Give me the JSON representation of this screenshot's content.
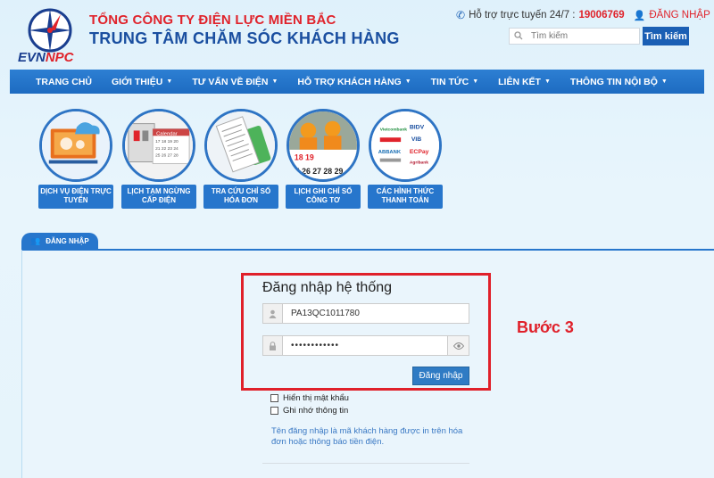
{
  "header": {
    "logo_main": "EVN",
    "logo_sub": "NPC",
    "company": "TỔNG CÔNG TY ĐIỆN LỰC MIỀN BẮC",
    "center_title": "TRUNG TÂM CHĂM SÓC KHÁCH HÀNG",
    "support_label": "Hỗ trợ trực tuyến 24/7 :",
    "hotline": "19006769",
    "login_link": "ĐĂNG NHẬP",
    "search_placeholder": "Tìm kiếm",
    "search_button": "Tìm kiếm"
  },
  "nav": {
    "items": [
      {
        "label": "TRANG CHỦ",
        "caret": false
      },
      {
        "label": "GIỚI THIỆU",
        "caret": true
      },
      {
        "label": "TƯ VẤN VỀ ĐIỆN",
        "caret": true
      },
      {
        "label": "HỖ TRỢ KHÁCH HÀNG",
        "caret": true
      },
      {
        "label": "TIN TỨC",
        "caret": true
      },
      {
        "label": "LIÊN KẾT",
        "caret": true
      },
      {
        "label": "THÔNG TIN NỘI BỘ",
        "caret": true
      }
    ]
  },
  "tiles": [
    {
      "line1": "DỊCH VỤ ĐIỆN TRỰC",
      "line2": "TUYẾN"
    },
    {
      "line1": "LỊCH TẠM NGỪNG",
      "line2": "CẤP ĐIỆN"
    },
    {
      "line1": "TRA CỨU CHỈ SỐ",
      "line2": "HÓA ĐƠN"
    },
    {
      "line1": "LỊCH GHI CHỈ SỐ",
      "line2": "CÔNG TƠ"
    },
    {
      "line1": "CÁC HÌNH THỨC",
      "line2": "THANH TOÁN"
    }
  ],
  "tile_art": {
    "calendar_word": "Calendar",
    "calendar_nums": "17 18 19 20 21 22 23 24 25 26 27 28",
    "cal2_row1": "18 19",
    "cal2_row2": "25 26 27 28 29",
    "banks": [
      "Vietcombank",
      "BIDV",
      "VIB",
      "ECPay",
      "ABBANK",
      "Agribank"
    ]
  },
  "tab": {
    "label": "ĐĂNG NHẬP"
  },
  "form": {
    "title": "Đăng nhập hệ thống",
    "username": "PA13QC1011780",
    "password": "••••••••••••",
    "submit": "Đăng nhập",
    "show_password": "Hiển thị mật khẩu",
    "remember": "Ghi nhớ thông tin",
    "hint": "Tên đăng nhập là mã khách hàng được in trên hóa đơn hoặc thông báo tiền điện."
  },
  "annotation": {
    "step": "Bước 3"
  },
  "colors": {
    "brand_blue": "#1a4fa0",
    "accent_red": "#e0232b",
    "nav_blue": "#2776cc"
  }
}
